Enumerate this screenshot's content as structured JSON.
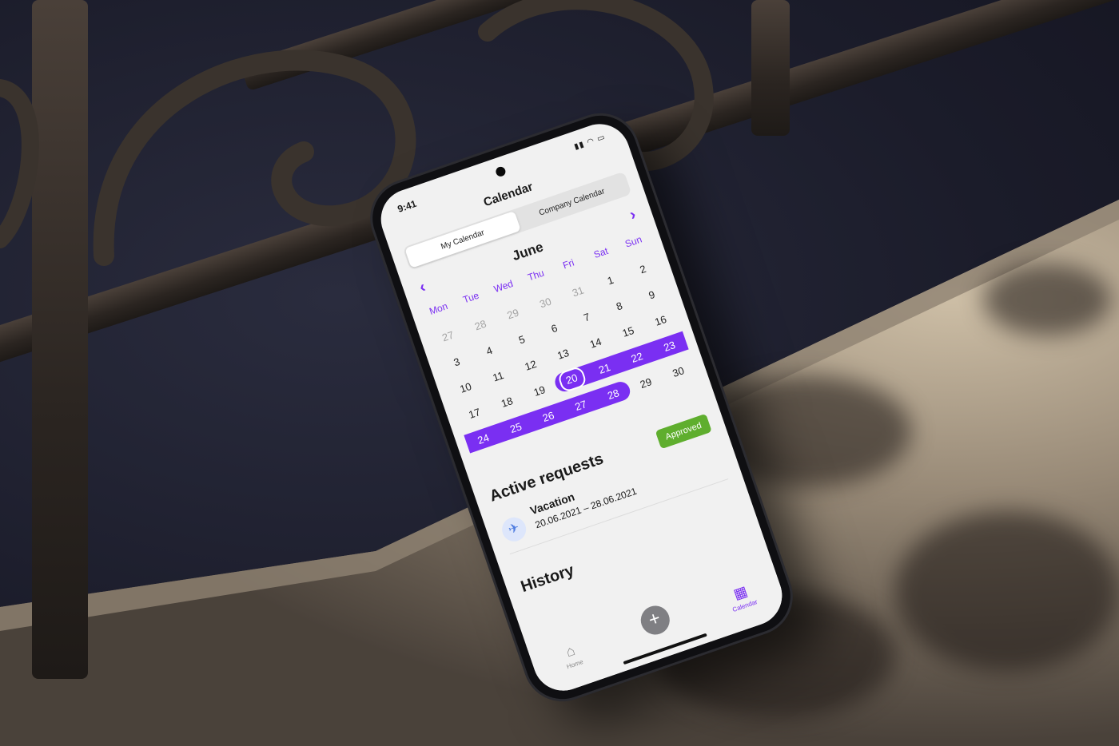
{
  "status_bar": {
    "time": "9:41",
    "icons": "▮▮ ◠ ▭"
  },
  "nav": {
    "title": "Calendar"
  },
  "segmented": {
    "tabs": [
      "My Calendar",
      "Company Calendar"
    ],
    "active_index": 0
  },
  "calendar": {
    "month": "June",
    "prev_icon": "chevron-left-icon",
    "next_icon": "chevron-right-icon",
    "weekdays": [
      "Mon",
      "Tue",
      "Wed",
      "Thu",
      "Fri",
      "Sat",
      "Sun"
    ],
    "weeks": [
      [
        "27",
        "28",
        "29",
        "30",
        "31",
        "1",
        "2"
      ],
      [
        "3",
        "4",
        "5",
        "6",
        "7",
        "8",
        "9"
      ],
      [
        "10",
        "11",
        "12",
        "13",
        "14",
        "15",
        "16"
      ],
      [
        "17",
        "18",
        "19",
        "20",
        "21",
        "22",
        "23"
      ],
      [
        "24",
        "25",
        "26",
        "27",
        "28",
        "29",
        "30"
      ]
    ],
    "muted_days_week0": 5,
    "range_start": "20",
    "range_end": "28",
    "accent_color": "#7a2ff2"
  },
  "active_requests": {
    "title": "Active requests",
    "items": [
      {
        "icon": "airplane-icon",
        "type": "Vacation",
        "dates": "20.06.2021 – 28.06.2021",
        "status": "Approved",
        "status_color": "#5fae2e"
      }
    ]
  },
  "history": {
    "title": "History"
  },
  "tabbar": {
    "home_label": "Home",
    "calendar_label": "Calendar",
    "add_label": "+"
  }
}
